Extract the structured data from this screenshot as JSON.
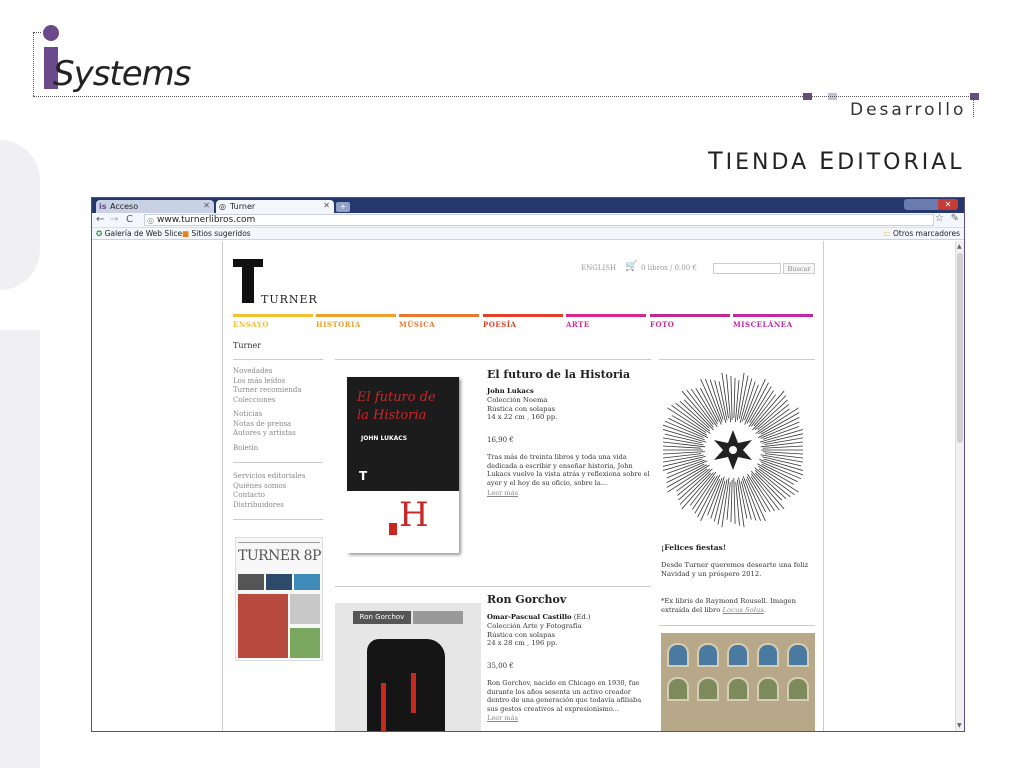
{
  "slide": {
    "logo_text": "Systems",
    "section_label": "Desarrollo",
    "title_first_initial": "T",
    "title_first_rest": "IENDA",
    "title_second_initial": "E",
    "title_second_rest": "DITORIAL",
    "accent_colors": [
      "#6b4a8c",
      "#b8a8cc",
      "#e6e0ee"
    ]
  },
  "browser": {
    "tabs": [
      {
        "label": "Acceso",
        "icon": "is-icon"
      },
      {
        "label": "Turner",
        "icon": "globe-icon"
      }
    ],
    "url": "www.turnerlibros.com",
    "bookmarks": {
      "left": [
        "Galería de Web Slice",
        "Sitios sugeridos"
      ],
      "right": "Otros marcadores"
    }
  },
  "site": {
    "brand": "TURNER",
    "lang_link": "ENGLISH",
    "cart": "0 libros / 0,00 €",
    "search_button": "Buscar",
    "nav": [
      {
        "label": "ENSAYO",
        "color": "#f2c230"
      },
      {
        "label": "HISTORIA",
        "color": "#f0a028"
      },
      {
        "label": "MÚSICA",
        "color": "#e8782a"
      },
      {
        "label": "POESÍA",
        "color": "#e04028"
      },
      {
        "label": "ARTE",
        "color": "#d8288c"
      },
      {
        "label": "FOTO",
        "color": "#c02896"
      },
      {
        "label": "MISCELÁNEA",
        "color": "#c026a8"
      }
    ],
    "breadcrumb": "Turner",
    "side_menu": {
      "group1": [
        "Novedades",
        "Los más leídos",
        "Turner recomienda",
        "Colecciones"
      ],
      "group2": [
        "Noticias",
        "Notas de prensa",
        "Autores y artistas"
      ],
      "group3": [
        "Boletín"
      ],
      "group4": [
        "Servicios editoriales",
        "Quiénes somos",
        "Contacto",
        "Distribuidores"
      ]
    },
    "magazine_title": "TURNER 8P",
    "books": [
      {
        "title": "El futuro de la Historia",
        "author": "John Lukacs",
        "collection": "Colección Noema",
        "binding": "Rústica con solapas",
        "size": "14 x 22 cm , 160 pp.",
        "price": "16,90 €",
        "desc": "Tras más de treinta libros y toda una vida dedicada a escribir y enseñar historia, John Lukacs vuelve la vista atrás y reflexiona sobre el ayer y el hoy de su oficio, sobre la...",
        "more": "Leer más",
        "cover_title_1": "El futuro de",
        "cover_title_2": "la Historia",
        "cover_author": "JOHN LUKACS",
        "cover_logo": "T",
        "cover_art": "H"
      },
      {
        "title": "Ron Gorchov",
        "author": "Omar-Pascual Castillo",
        "author_suffix": "(Ed.)",
        "collection": "Colección Arte y Fotografía",
        "binding": "Rústica con solapas",
        "size": "24 x 28 cm , 196 pp.",
        "price": "35,00 €",
        "desc": "Ron Gorchov, nacido en Chicago en 1930, fue durante los años sesenta un activo creador dentro de una generación que todavía afiliaba sus gestos creativos al expresionismo...",
        "more": "Leer más",
        "cover_label": "Ron Gorchov"
      }
    ],
    "right_column": {
      "greeting_title": "¡Felices fiestas!",
      "greeting_text": "Desde Turner queremos desearte una feliz Navidad y un próspero 2012.",
      "credit_text": "*Ex libris de Raymond Rousell. Imagen extraída del libro",
      "credit_book": "Locus Solus"
    }
  }
}
